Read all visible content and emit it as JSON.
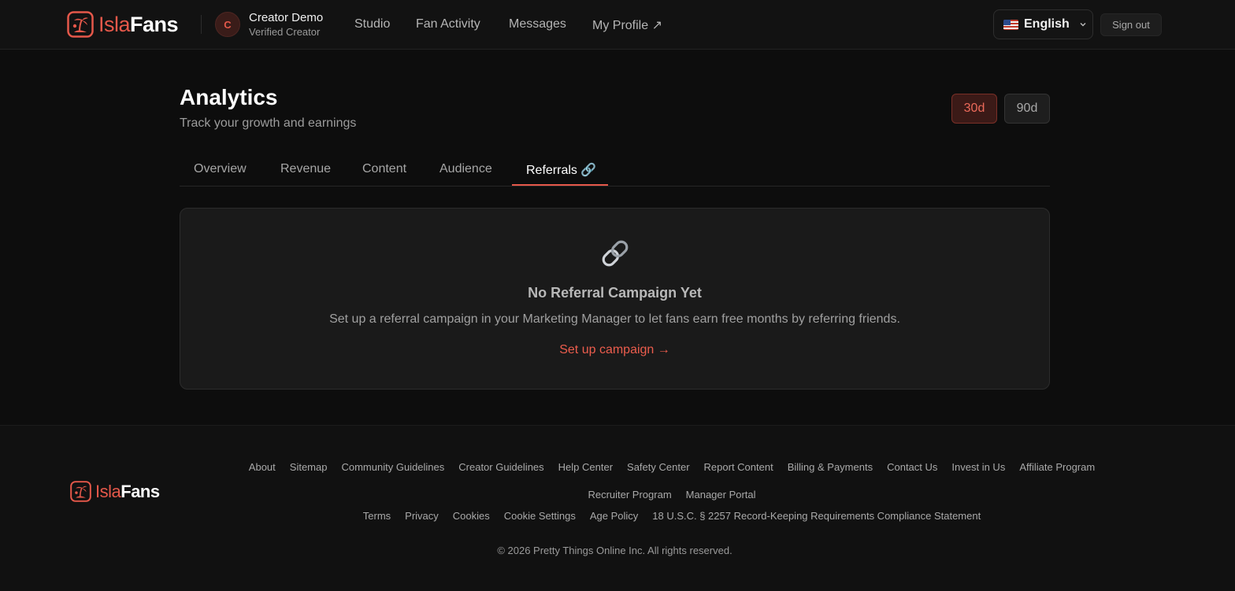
{
  "brand": {
    "part1": "Isla",
    "part2": "Fans",
    "accent": "#e5584a"
  },
  "user": {
    "initial": "C",
    "name": "Creator Demo",
    "role": "Verified Creator"
  },
  "nav": {
    "items": [
      {
        "label": "Studio"
      },
      {
        "label": "Fan Activity"
      },
      {
        "label": "Messages"
      },
      {
        "label": "My Profile ↗"
      }
    ]
  },
  "header": {
    "language": "English",
    "language_icon": "us-flag-icon",
    "signout": "Sign out"
  },
  "page": {
    "title": "Analytics",
    "subtitle": "Track your growth and earnings",
    "ranges": [
      "30d",
      "90d"
    ],
    "selected_range": "30d"
  },
  "tabs": [
    {
      "label": "Overview"
    },
    {
      "label": "Revenue"
    },
    {
      "label": "Content"
    },
    {
      "label": "Audience"
    },
    {
      "label": "Referrals 🔗"
    }
  ],
  "active_tab": "Referrals 🔗",
  "empty_state": {
    "icon": "link-icon",
    "title": "No Referral Campaign Yet",
    "description": "Set up a referral campaign in your Marketing Manager to let fans earn free months by referring friends.",
    "cta": "Set up campaign →"
  },
  "footer": {
    "row1": [
      "About",
      "Sitemap",
      "Community Guidelines",
      "Creator Guidelines",
      "Help Center",
      "Safety Center",
      "Report Content",
      "Billing & Payments",
      "Contact Us",
      "Invest in Us",
      "Affiliate Program"
    ],
    "row2": [
      "Recruiter Program",
      "Manager Portal"
    ],
    "row3": [
      "Terms",
      "Privacy",
      "Cookies",
      "Cookie Settings",
      "Age Policy",
      "18 U.S.C. § 2257 Record-Keeping Requirements Compliance Statement"
    ],
    "copyright": "© 2026 Pretty Things Online Inc. All rights reserved."
  }
}
